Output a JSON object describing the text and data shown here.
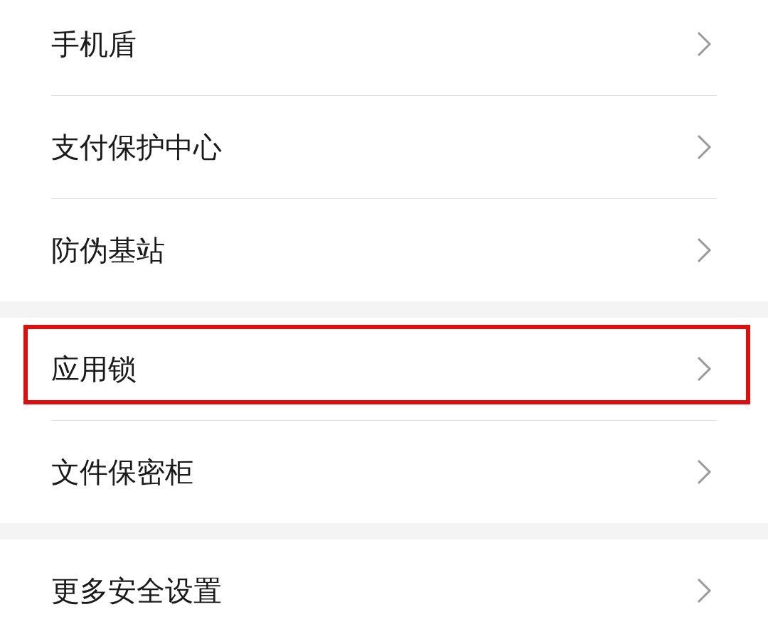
{
  "sections": [
    {
      "items": [
        {
          "label": "手机盾",
          "highlighted": false
        },
        {
          "label": "支付保护中心",
          "highlighted": false
        },
        {
          "label": "防伪基站",
          "highlighted": false
        }
      ]
    },
    {
      "items": [
        {
          "label": "应用锁",
          "highlighted": true
        },
        {
          "label": "文件保密柜",
          "highlighted": false
        }
      ]
    },
    {
      "items": [
        {
          "label": "更多安全设置",
          "highlighted": false
        }
      ]
    }
  ]
}
